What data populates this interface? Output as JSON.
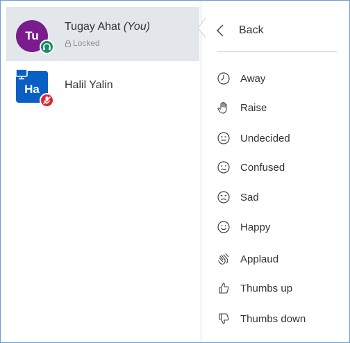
{
  "users": [
    {
      "initials": "Tu",
      "name": "Tugay Ahat",
      "you_tag": "(You)",
      "status": "Locked"
    },
    {
      "initials": "Ha",
      "name": "Halil Yalin"
    }
  ],
  "menu": {
    "back_label": "Back",
    "items": [
      {
        "label": "Away",
        "icon": "clock-icon"
      },
      {
        "label": "Raise",
        "icon": "raised-hand-icon"
      },
      {
        "label": "Undecided",
        "icon": "undecided-face-icon"
      },
      {
        "label": "Confused",
        "icon": "confused-face-icon"
      },
      {
        "label": "Sad",
        "icon": "sad-face-icon"
      },
      {
        "label": "Happy",
        "icon": "happy-face-icon"
      },
      {
        "label": "Applaud",
        "icon": "clapping-hands-icon"
      },
      {
        "label": "Thumbs up",
        "icon": "thumbs-up-icon"
      },
      {
        "label": "Thumbs down",
        "icon": "thumbs-down-icon"
      }
    ]
  },
  "colors": {
    "selected_row_bg": "#e3e6ea",
    "avatar_purple": "#7a1c8c",
    "avatar_blue": "#0a5fc4",
    "headset_badge": "#178c66",
    "muted_badge": "#e0262b",
    "frame_border": "#6f9bc9"
  }
}
